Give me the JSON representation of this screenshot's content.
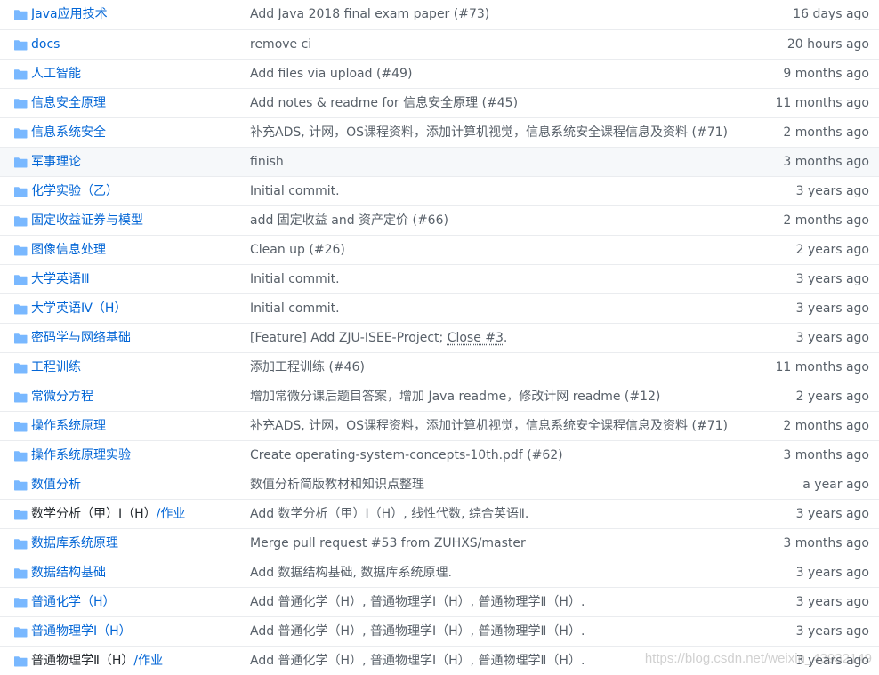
{
  "colors": {
    "link": "#0366d6",
    "text_muted": "#586069",
    "folder_icon": "#79b8ff",
    "row_border": "#eaecef",
    "row_highlight": "#f6f8fa"
  },
  "rows": [
    {
      "name": "Java应用技术",
      "message": "Add Java 2018 final exam paper (#73)",
      "age": "16 days ago",
      "icon": "folder-icon"
    },
    {
      "name": "docs",
      "message": "remove ci",
      "age": "20 hours ago",
      "icon": "folder-icon"
    },
    {
      "name": "人工智能",
      "message": "Add files via upload (#49)",
      "age": "9 months ago",
      "icon": "folder-icon"
    },
    {
      "name": "信息安全原理",
      "message": "Add notes & readme for 信息安全原理 (#45)",
      "age": "11 months ago",
      "icon": "folder-icon"
    },
    {
      "name": "信息系统安全",
      "message": "补充ADS, 计网，OS课程资料，添加计算机视觉，信息系统安全课程信息及资料 (#71)",
      "age": "2 months ago",
      "icon": "folder-icon"
    },
    {
      "name": "军事理论",
      "message": "finish",
      "age": "3 months ago",
      "icon": "folder-icon",
      "highlight": true
    },
    {
      "name": "化学实验（乙）",
      "message": "Initial commit.",
      "age": "3 years ago",
      "icon": "folder-icon"
    },
    {
      "name": "固定收益证券与模型",
      "message": "add 固定收益 and 资产定价 (#66)",
      "age": "2 months ago",
      "icon": "folder-icon"
    },
    {
      "name": "图像信息处理",
      "message": "Clean up (#26)",
      "age": "2 years ago",
      "icon": "folder-icon"
    },
    {
      "name": "大学英语Ⅲ",
      "message": "Initial commit.",
      "age": "3 years ago",
      "icon": "folder-icon"
    },
    {
      "name": "大学英语Ⅳ（H）",
      "message": "Initial commit.",
      "age": "3 years ago",
      "icon": "folder-icon"
    },
    {
      "name": "密码学与网络基础",
      "message": "[Feature] Add ZJU-ISEE-Project; ",
      "message_link": "Close #3",
      "message_tail": ".",
      "age": "3 years ago",
      "icon": "folder-icon"
    },
    {
      "name": "工程训练",
      "message": "添加工程训练 (#46)",
      "age": "11 months ago",
      "icon": "folder-icon"
    },
    {
      "name": "常微分方程",
      "message": "增加常微分课后题目答案，增加 Java readme，修改计网 readme (#12)",
      "age": "2 years ago",
      "icon": "folder-icon"
    },
    {
      "name": "操作系统原理",
      "message": "补充ADS, 计网，OS课程资料，添加计算机视觉，信息系统安全课程信息及资料 (#71)",
      "age": "2 months ago",
      "icon": "folder-icon"
    },
    {
      "name": "操作系统原理实验",
      "message": "Create operating-system-concepts-10th.pdf (#62)",
      "age": "3 months ago",
      "icon": "folder-icon"
    },
    {
      "name": "数值分析",
      "message": "数值分析简版教材和知识点整理",
      "age": "a year ago",
      "icon": "folder-icon"
    },
    {
      "name": "数学分析（甲）Ⅰ（H）",
      "name_sub": "/作业",
      "message": "Add 数学分析（甲）Ⅰ（H）, 线性代数, 综合英语Ⅱ.",
      "age": "3 years ago",
      "icon": "folder-icon"
    },
    {
      "name": "数据库系统原理",
      "message": "Merge pull request #53 from ZUHXS/master",
      "age": "3 months ago",
      "icon": "folder-icon"
    },
    {
      "name": "数据结构基础",
      "message": "Add 数据结构基础, 数据库系统原理.",
      "age": "3 years ago",
      "icon": "folder-icon"
    },
    {
      "name": "普通化学（H）",
      "message": "Add 普通化学（H）, 普通物理学Ⅰ（H）, 普通物理学Ⅱ（H）.",
      "age": "3 years ago",
      "icon": "folder-icon"
    },
    {
      "name": "普通物理学Ⅰ（H）",
      "message": "Add 普通化学（H）, 普通物理学Ⅰ（H）, 普通物理学Ⅱ（H）.",
      "age": "3 years ago",
      "icon": "folder-icon"
    },
    {
      "name": "普通物理学Ⅱ（H）",
      "name_sub": "/作业",
      "message": "Add 普通化学（H）, 普通物理学Ⅰ（H）, 普通物理学Ⅱ（H）.",
      "age": "3 years ago",
      "icon": "folder-icon"
    }
  ],
  "watermark": "https://blog.csdn.net/weixin_43932149"
}
